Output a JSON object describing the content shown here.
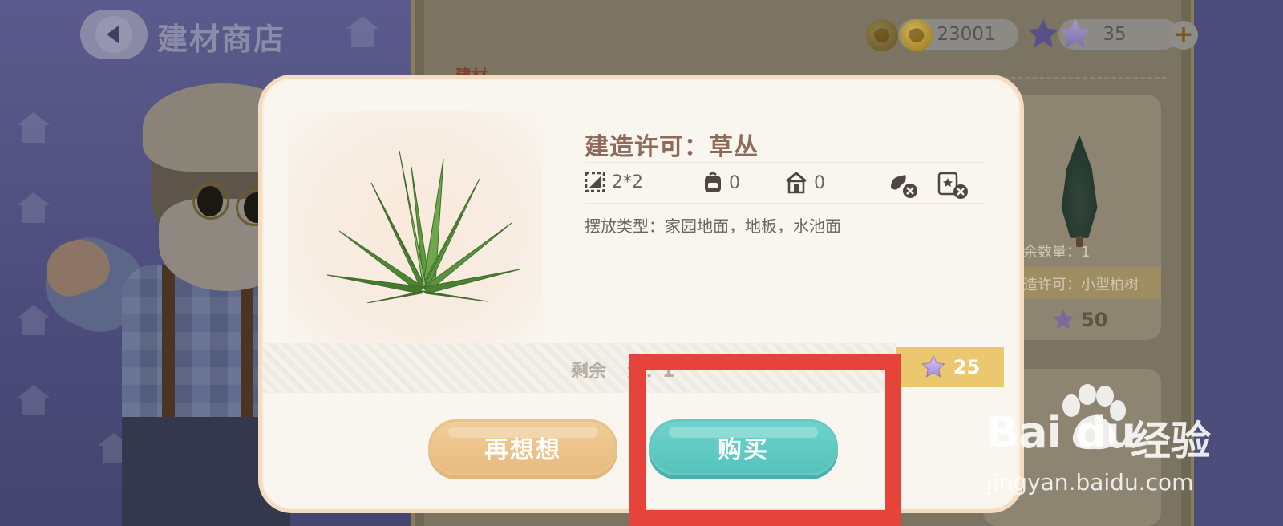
{
  "header": {
    "back_icon": "back-arrow-icon",
    "title": "建材商店"
  },
  "currency": {
    "coins": "23001",
    "stars": "35",
    "add_symbol": "+"
  },
  "shop": {
    "category_label": "建材",
    "card_right": {
      "remaining": "余数量：1",
      "name": "造许可：小型柏树",
      "price": "50"
    }
  },
  "modal": {
    "title": "建造许可：草丛",
    "stats": {
      "size": "2*2",
      "bag_count": "0",
      "house_count": "0"
    },
    "placement_type": "摆放类型：家园地面，地板，水池面",
    "stock_left": "剩余",
    "stock_right": "量：1",
    "price": "25",
    "cancel_label": "再想想",
    "buy_label": "购买"
  },
  "watermark": {
    "brand": "Bai du",
    "cn": "经验",
    "url": "jingyan.baidu.com"
  },
  "colors": {
    "buy_button": "#5cc9c2",
    "rethink_button": "#ecc38b",
    "price_tag": "#ebc770",
    "highlight": "#e6433a"
  }
}
